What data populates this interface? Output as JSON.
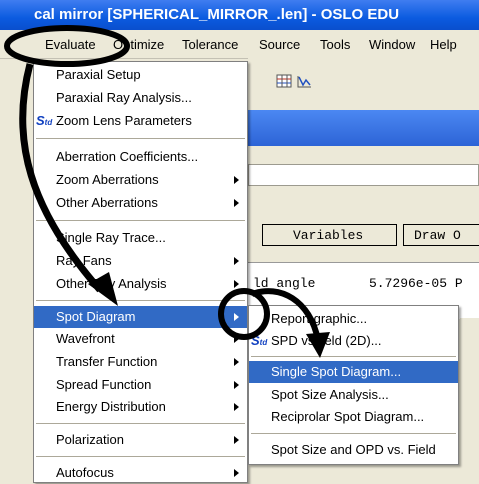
{
  "window": {
    "title": "cal mirror [SPHERICAL_MIRROR_.len] - OSLO EDU"
  },
  "menubar": {
    "items": [
      {
        "label": "Evaluate"
      },
      {
        "label": "Optimize"
      },
      {
        "label": "Tolerance"
      },
      {
        "label": "Source"
      },
      {
        "label": "Tools"
      },
      {
        "label": "Window"
      },
      {
        "label": "Help"
      }
    ]
  },
  "background": {
    "buttons": [
      "Variables",
      "Draw O"
    ],
    "text_row": {
      "label": "ld angle",
      "value": "5.7296e-05 P"
    }
  },
  "evaluate_menu": {
    "items": [
      {
        "label": "Paraxial Setup",
        "submenu": false
      },
      {
        "label": "Paraxial Ray Analysis...",
        "submenu": false
      },
      {
        "label": "Zoom Lens Parameters",
        "submenu": false,
        "icon": "std-icon"
      },
      {
        "label": "Aberration Coefficients...",
        "submenu": false
      },
      {
        "label": "Zoom Aberrations",
        "submenu": true
      },
      {
        "label": "Other Aberrations",
        "submenu": true
      },
      {
        "label": "Single Ray Trace...",
        "submenu": false
      },
      {
        "label": "Ray Fans",
        "submenu": true
      },
      {
        "label": "Other Ray Analysis",
        "submenu": true
      },
      {
        "label": "Spot Diagram",
        "submenu": true,
        "highlighted": true
      },
      {
        "label": "Wavefront",
        "submenu": true
      },
      {
        "label": "Transfer Function",
        "submenu": true
      },
      {
        "label": "Spread Function",
        "submenu": true
      },
      {
        "label": "Energy Distribution",
        "submenu": true
      },
      {
        "label": "Polarization",
        "submenu": true
      },
      {
        "label": "Autofocus",
        "submenu": true
      }
    ]
  },
  "spot_submenu": {
    "items": [
      {
        "label": "Report graphic..."
      },
      {
        "label": "SPD vs field (2D)...",
        "icon": "std-icon"
      },
      {
        "label": "Single Spot Diagram...",
        "highlighted": true
      },
      {
        "label": "Spot Size Analysis..."
      },
      {
        "label": "Reciprolar Spot Diagram..."
      },
      {
        "label": "Spot Size and OPD vs. Field"
      }
    ]
  },
  "std_icon": {
    "label": "S",
    "sub": "td"
  },
  "colors": {
    "highlight": "#316ac5",
    "title_bar": "#0b5be0",
    "annotation": "#000000"
  }
}
